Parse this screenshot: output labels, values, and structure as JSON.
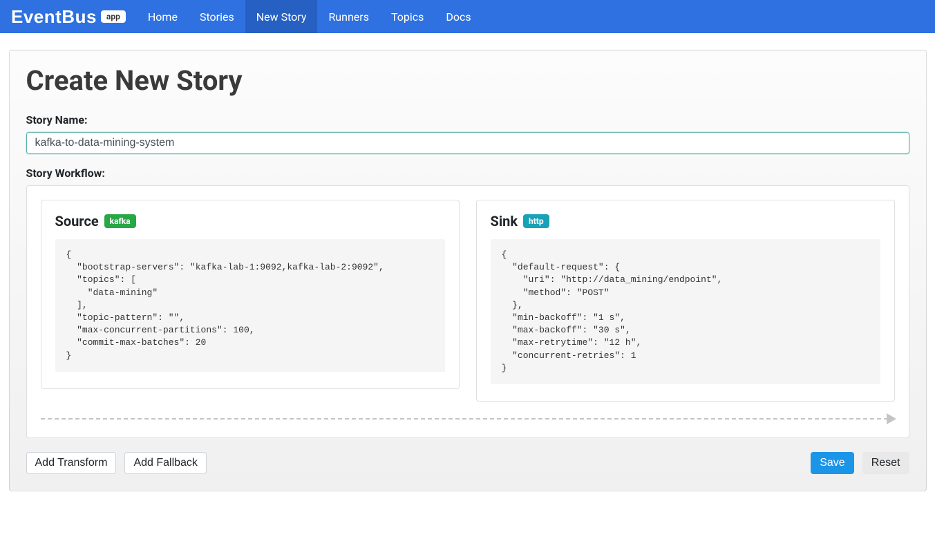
{
  "brand": {
    "name": "EventBus",
    "badge": "app"
  },
  "nav": {
    "items": [
      {
        "label": "Home"
      },
      {
        "label": "Stories"
      },
      {
        "label": "New Story"
      },
      {
        "label": "Runners"
      },
      {
        "label": "Topics"
      },
      {
        "label": "Docs"
      }
    ],
    "activeIndex": 2
  },
  "page": {
    "title": "Create New Story",
    "storyNameLabel": "Story Name:",
    "storyNameValue": "kafka-to-data-mining-system",
    "workflowLabel": "Story Workflow:"
  },
  "source": {
    "title": "Source",
    "badge": "kafka",
    "config": "{\n  \"bootstrap-servers\": \"kafka-lab-1:9092,kafka-lab-2:9092\",\n  \"topics\": [\n    \"data-mining\"\n  ],\n  \"topic-pattern\": \"\",\n  \"max-concurrent-partitions\": 100,\n  \"commit-max-batches\": 20\n}"
  },
  "sink": {
    "title": "Sink",
    "badge": "http",
    "config": "{\n  \"default-request\": {\n    \"uri\": \"http://data_mining/endpoint\",\n    \"method\": \"POST\"\n  },\n  \"min-backoff\": \"1 s\",\n  \"max-backoff\": \"30 s\",\n  \"max-retrytime\": \"12 h\",\n  \"concurrent-retries\": 1\n}"
  },
  "actions": {
    "addTransform": "Add Transform",
    "addFallback": "Add Fallback",
    "save": "Save",
    "reset": "Reset"
  }
}
